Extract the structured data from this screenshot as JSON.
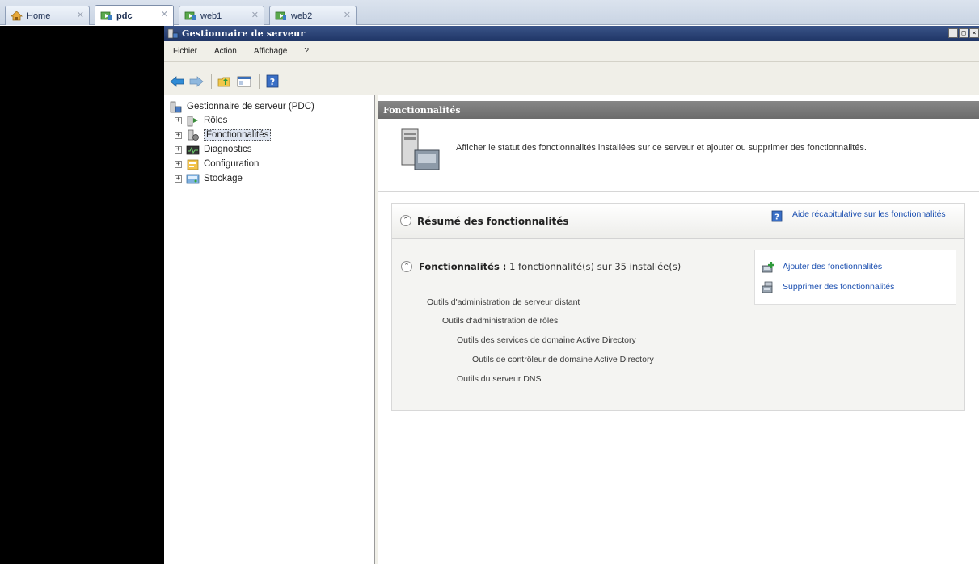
{
  "vm_tabs": [
    {
      "label": "Home",
      "active": false
    },
    {
      "label": "pdc",
      "active": true
    },
    {
      "label": "web1",
      "active": false
    },
    {
      "label": "web2",
      "active": false
    }
  ],
  "window": {
    "title": "Gestionnaire de serveur",
    "controls": [
      "_",
      "□",
      "×"
    ]
  },
  "menubar": [
    "Fichier",
    "Action",
    "Affichage",
    "?"
  ],
  "toolbar": [
    "back-arrow-icon",
    "forward-arrow-icon",
    "folder-up-icon",
    "console-icon",
    "help-icon"
  ],
  "tree": {
    "root": "Gestionnaire de serveur (PDC)",
    "items": [
      {
        "label": "Rôles",
        "icon": "roles-icon",
        "selected": false
      },
      {
        "label": "Fonctionnalités",
        "icon": "features-icon",
        "selected": true
      },
      {
        "label": "Diagnostics",
        "icon": "diagnostics-icon",
        "selected": false
      },
      {
        "label": "Configuration",
        "icon": "configuration-icon",
        "selected": false
      },
      {
        "label": "Stockage",
        "icon": "storage-icon",
        "selected": false
      }
    ]
  },
  "content": {
    "header": "Fonctionnalités",
    "description": "Afficher le statut des fonctionnalités installées sur ce serveur et ajouter ou supprimer des fonctionnalités.",
    "summary": {
      "title": "Résumé des fonctionnalités",
      "help_link": "Aide récapitulative sur les fonctionnalités",
      "features_label": "Fonctionnalités :",
      "features_count": "1 fonctionnalité(s) sur 35 installée(s)",
      "feature_tree": [
        "Outils d'administration de serveur distant",
        "Outils d'administration de rôles",
        "Outils des services de domaine Active Directory",
        "Outils de contrôleur de domaine Active Directory",
        "Outils du serveur DNS"
      ],
      "actions": [
        {
          "label": "Ajouter des fonctionnalités",
          "icon": "add-features-icon"
        },
        {
          "label": "Supprimer des fonctionnalités",
          "icon": "remove-features-icon"
        }
      ]
    }
  },
  "colors": {
    "title_bar": "#1f3566",
    "pane_header": "#777777",
    "link": "#1b4fb0"
  }
}
